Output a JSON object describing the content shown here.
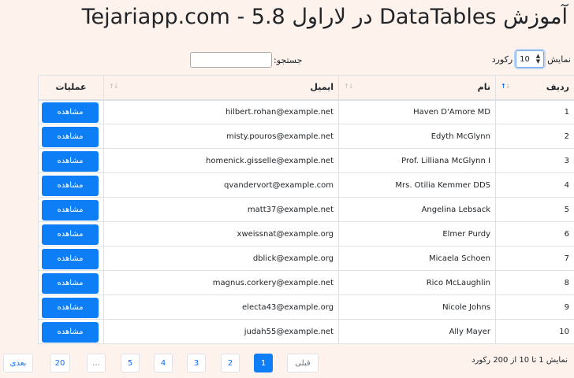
{
  "title": "آموزش DataTables در لاراول 5.8 - Tejariapp.com",
  "length": {
    "label_before": "نمایش",
    "value": "10",
    "label_after": "رکورد"
  },
  "search": {
    "label": "جستجو:",
    "value": "",
    "placeholder": ""
  },
  "table": {
    "columns": [
      "ردیف",
      "نام",
      "ایمیل",
      "عملیات"
    ],
    "sorted_column": "ردیف",
    "sort_direction": "ascending",
    "rows": [
      {
        "id": "1",
        "name": "Haven D'Amore MD",
        "email": "hilbert.rohan@example.net",
        "action": "مشاهده"
      },
      {
        "id": "2",
        "name": "Edyth McGlynn",
        "email": "misty.pouros@example.net",
        "action": "مشاهده"
      },
      {
        "id": "3",
        "name": "Prof. Lilliana McGlynn I",
        "email": "homenick.gisselle@example.net",
        "action": "مشاهده"
      },
      {
        "id": "4",
        "name": "Mrs. Otilia Kemmer DDS",
        "email": "qvandervort@example.com",
        "action": "مشاهده"
      },
      {
        "id": "5",
        "name": "Angelina Lebsack",
        "email": "matt37@example.net",
        "action": "مشاهده"
      },
      {
        "id": "6",
        "name": "Elmer Purdy",
        "email": "xweissnat@example.org",
        "action": "مشاهده"
      },
      {
        "id": "7",
        "name": "Micaela Schoen",
        "email": "dblick@example.org",
        "action": "مشاهده"
      },
      {
        "id": "8",
        "name": "Rico McLaughlin",
        "email": "magnus.corkery@example.net",
        "action": "مشاهده"
      },
      {
        "id": "9",
        "name": "Nicole Johns",
        "email": "electa43@example.org",
        "action": "مشاهده"
      },
      {
        "id": "10",
        "name": "Ally Mayer",
        "email": "judah55@example.net",
        "action": "مشاهده"
      }
    ]
  },
  "info": "نمایش 1 تا 10 از 200 رکورد",
  "pagination": {
    "previous": "قبلی",
    "next": "بعدی",
    "pages": [
      "1",
      "2",
      "3",
      "4",
      "5",
      "...",
      "20"
    ],
    "active_page": "1"
  },
  "colors": {
    "background": "#fdf3ec",
    "primary": "#0d7ef5",
    "border": "#dee2e6"
  }
}
